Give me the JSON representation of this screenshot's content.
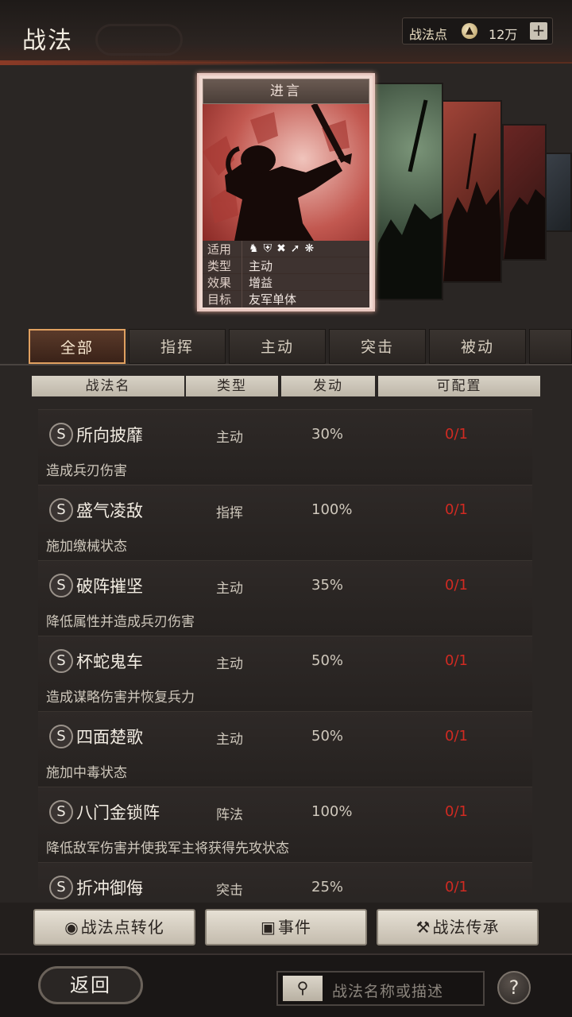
{
  "header": {
    "title": "战法",
    "points_label": "战法点",
    "points_value": "12万",
    "add_label": "+"
  },
  "card": {
    "title": "进言",
    "info": [
      {
        "key": "适用",
        "value": ""
      },
      {
        "key": "类型",
        "value": "主动"
      },
      {
        "key": "效果",
        "value": "增益"
      },
      {
        "key": "目标",
        "value": "友军单体"
      }
    ],
    "unit_icons": [
      "cavalry-icon",
      "shield-icon",
      "bow-icon",
      "spear-icon",
      "wheel-icon"
    ]
  },
  "tabs": [
    "全部",
    "指挥",
    "主动",
    "突击",
    "被动"
  ],
  "columns": [
    "战法名",
    "类型",
    "发动",
    "可配置"
  ],
  "skills": [
    {
      "grade": "S",
      "name": "所向披靡",
      "type": "主动",
      "rate": "30%",
      "config": "0/1",
      "desc": "造成兵刃伤害"
    },
    {
      "grade": "S",
      "name": "盛气凌敌",
      "type": "指挥",
      "rate": "100%",
      "config": "0/1",
      "desc": "施加缴械状态"
    },
    {
      "grade": "S",
      "name": "破阵摧坚",
      "type": "主动",
      "rate": "35%",
      "config": "0/1",
      "desc": "降低属性并造成兵刃伤害"
    },
    {
      "grade": "S",
      "name": "杯蛇鬼车",
      "type": "主动",
      "rate": "50%",
      "config": "0/1",
      "desc": "造成谋略伤害并恢复兵力"
    },
    {
      "grade": "S",
      "name": "四面楚歌",
      "type": "主动",
      "rate": "50%",
      "config": "0/1",
      "desc": "施加中毒状态"
    },
    {
      "grade": "S",
      "name": "八门金锁阵",
      "type": "阵法",
      "rate": "100%",
      "config": "0/1",
      "desc": "降低敌军伤害并使我军主将获得先攻状态"
    },
    {
      "grade": "S",
      "name": "折冲御侮",
      "type": "突击",
      "rate": "25%",
      "config": "0/1",
      "desc": ""
    }
  ],
  "actions": {
    "convert_label": "战法点转化",
    "event_label": "事件",
    "inherit_label": "战法传承"
  },
  "footer": {
    "back_label": "返回",
    "search_placeholder": "战法名称或描述",
    "help_label": "?"
  }
}
